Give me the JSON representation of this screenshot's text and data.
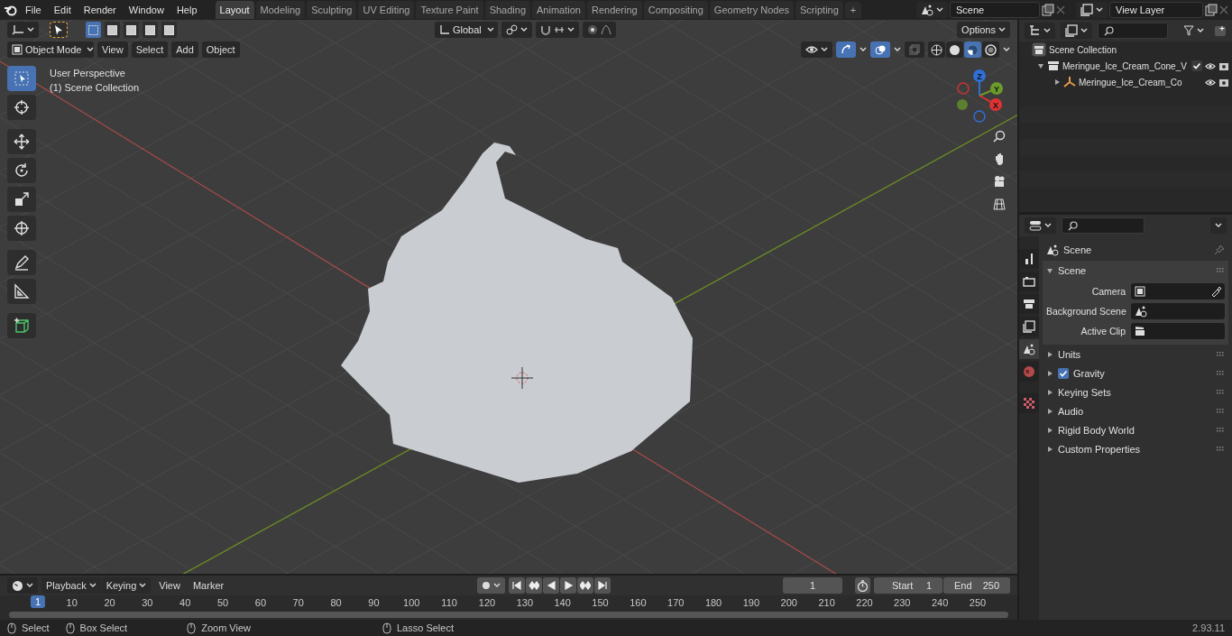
{
  "menu": [
    "File",
    "Edit",
    "Render",
    "Window",
    "Help"
  ],
  "workspaces": [
    {
      "label": "Layout",
      "selected": true
    },
    {
      "label": "Modeling",
      "selected": false
    },
    {
      "label": "Sculpting",
      "selected": false
    },
    {
      "label": "UV Editing",
      "selected": false
    },
    {
      "label": "Texture Paint",
      "selected": false
    },
    {
      "label": "Shading",
      "selected": false
    },
    {
      "label": "Animation",
      "selected": false
    },
    {
      "label": "Rendering",
      "selected": false
    },
    {
      "label": "Compositing",
      "selected": false
    },
    {
      "label": "Geometry Nodes",
      "selected": false
    },
    {
      "label": "Scripting",
      "selected": false
    }
  ],
  "add_workspace": "+",
  "scene_field": {
    "value": "Scene"
  },
  "view_layer_field": {
    "value": "View Layer"
  },
  "viewport": {
    "select_modes": [
      {
        "selected": true
      },
      {
        "selected": false
      },
      {
        "selected": false
      },
      {
        "selected": false
      },
      {
        "selected": false
      }
    ],
    "transform_orientation": "Global",
    "options": "Options",
    "mode": "Object Mode",
    "menus": [
      "View",
      "Select",
      "Add",
      "Object"
    ],
    "overlay_lines": [
      "User Perspective",
      "(1) Scene Collection"
    ],
    "shading": [
      {
        "selected": false
      },
      {
        "selected": false
      },
      {
        "selected": true
      },
      {
        "selected": false
      }
    ],
    "tools": [
      {
        "kind": "select",
        "selected": true
      },
      {
        "kind": "cursor",
        "selected": false
      },
      {
        "kind": "move",
        "selected": false
      },
      {
        "kind": "rotate",
        "selected": false
      },
      {
        "kind": "scale",
        "selected": false
      },
      {
        "kind": "transform",
        "selected": false
      },
      {
        "kind": "annotate",
        "selected": false
      },
      {
        "kind": "measure",
        "selected": false
      },
      {
        "kind": "add-cube",
        "selected": false
      }
    ],
    "gizmo_axes": [
      "Z",
      "Y",
      "X"
    ]
  },
  "outliner": {
    "items": [
      {
        "label": "Scene Collection",
        "kind": "scene",
        "children": [
          {
            "label": "Meringue_Ice_Cream_Cone_V",
            "kind": "collection",
            "expanded": true,
            "checked": true,
            "children": [
              {
                "label": "Meringue_Ice_Cream_Co",
                "kind": "object",
                "expanded": false
              }
            ]
          }
        ]
      }
    ]
  },
  "properties": {
    "tabs": [
      {
        "kind": "tool",
        "selected": false
      },
      {
        "kind": "render",
        "selected": false
      },
      {
        "kind": "output",
        "selected": false
      },
      {
        "kind": "view-layer",
        "selected": false
      },
      {
        "kind": "scene",
        "selected": true
      },
      {
        "kind": "world",
        "selected": false
      },
      {
        "kind": "texture",
        "selected": false
      }
    ],
    "context": "Scene",
    "panel": {
      "title": "Scene",
      "expanded": true,
      "fields": [
        {
          "label": "Camera",
          "kind": "camera"
        },
        {
          "label": "Background Scene",
          "kind": "scene"
        },
        {
          "label": "Active Clip",
          "kind": "clip"
        }
      ]
    },
    "subpanels": [
      {
        "title": "Units",
        "kind": "plain",
        "expanded": false
      },
      {
        "title": "Gravity",
        "kind": "checkbox",
        "checked": true,
        "expanded": false
      },
      {
        "title": "Keying Sets",
        "kind": "plain",
        "expanded": false
      },
      {
        "title": "Audio",
        "kind": "plain",
        "expanded": false
      },
      {
        "title": "Rigid Body World",
        "kind": "plain",
        "expanded": false
      },
      {
        "title": "Custom Properties",
        "kind": "plain",
        "expanded": false
      }
    ]
  },
  "timeline": {
    "menus": [
      "Playback",
      "Keying",
      "View",
      "Marker"
    ],
    "current_frame": "1",
    "start_label": "Start",
    "start": "1",
    "end_label": "End",
    "end": "250",
    "ticks": [
      "1",
      "10",
      "20",
      "30",
      "40",
      "50",
      "60",
      "70",
      "80",
      "90",
      "100",
      "110",
      "120",
      "130",
      "140",
      "150",
      "160",
      "170",
      "180",
      "190",
      "200",
      "210",
      "220",
      "230",
      "240",
      "250"
    ]
  },
  "status_bar": {
    "hints": [
      "Select",
      "Box Select",
      "Zoom View",
      "Lasso Select"
    ],
    "version": "2.93.11"
  }
}
